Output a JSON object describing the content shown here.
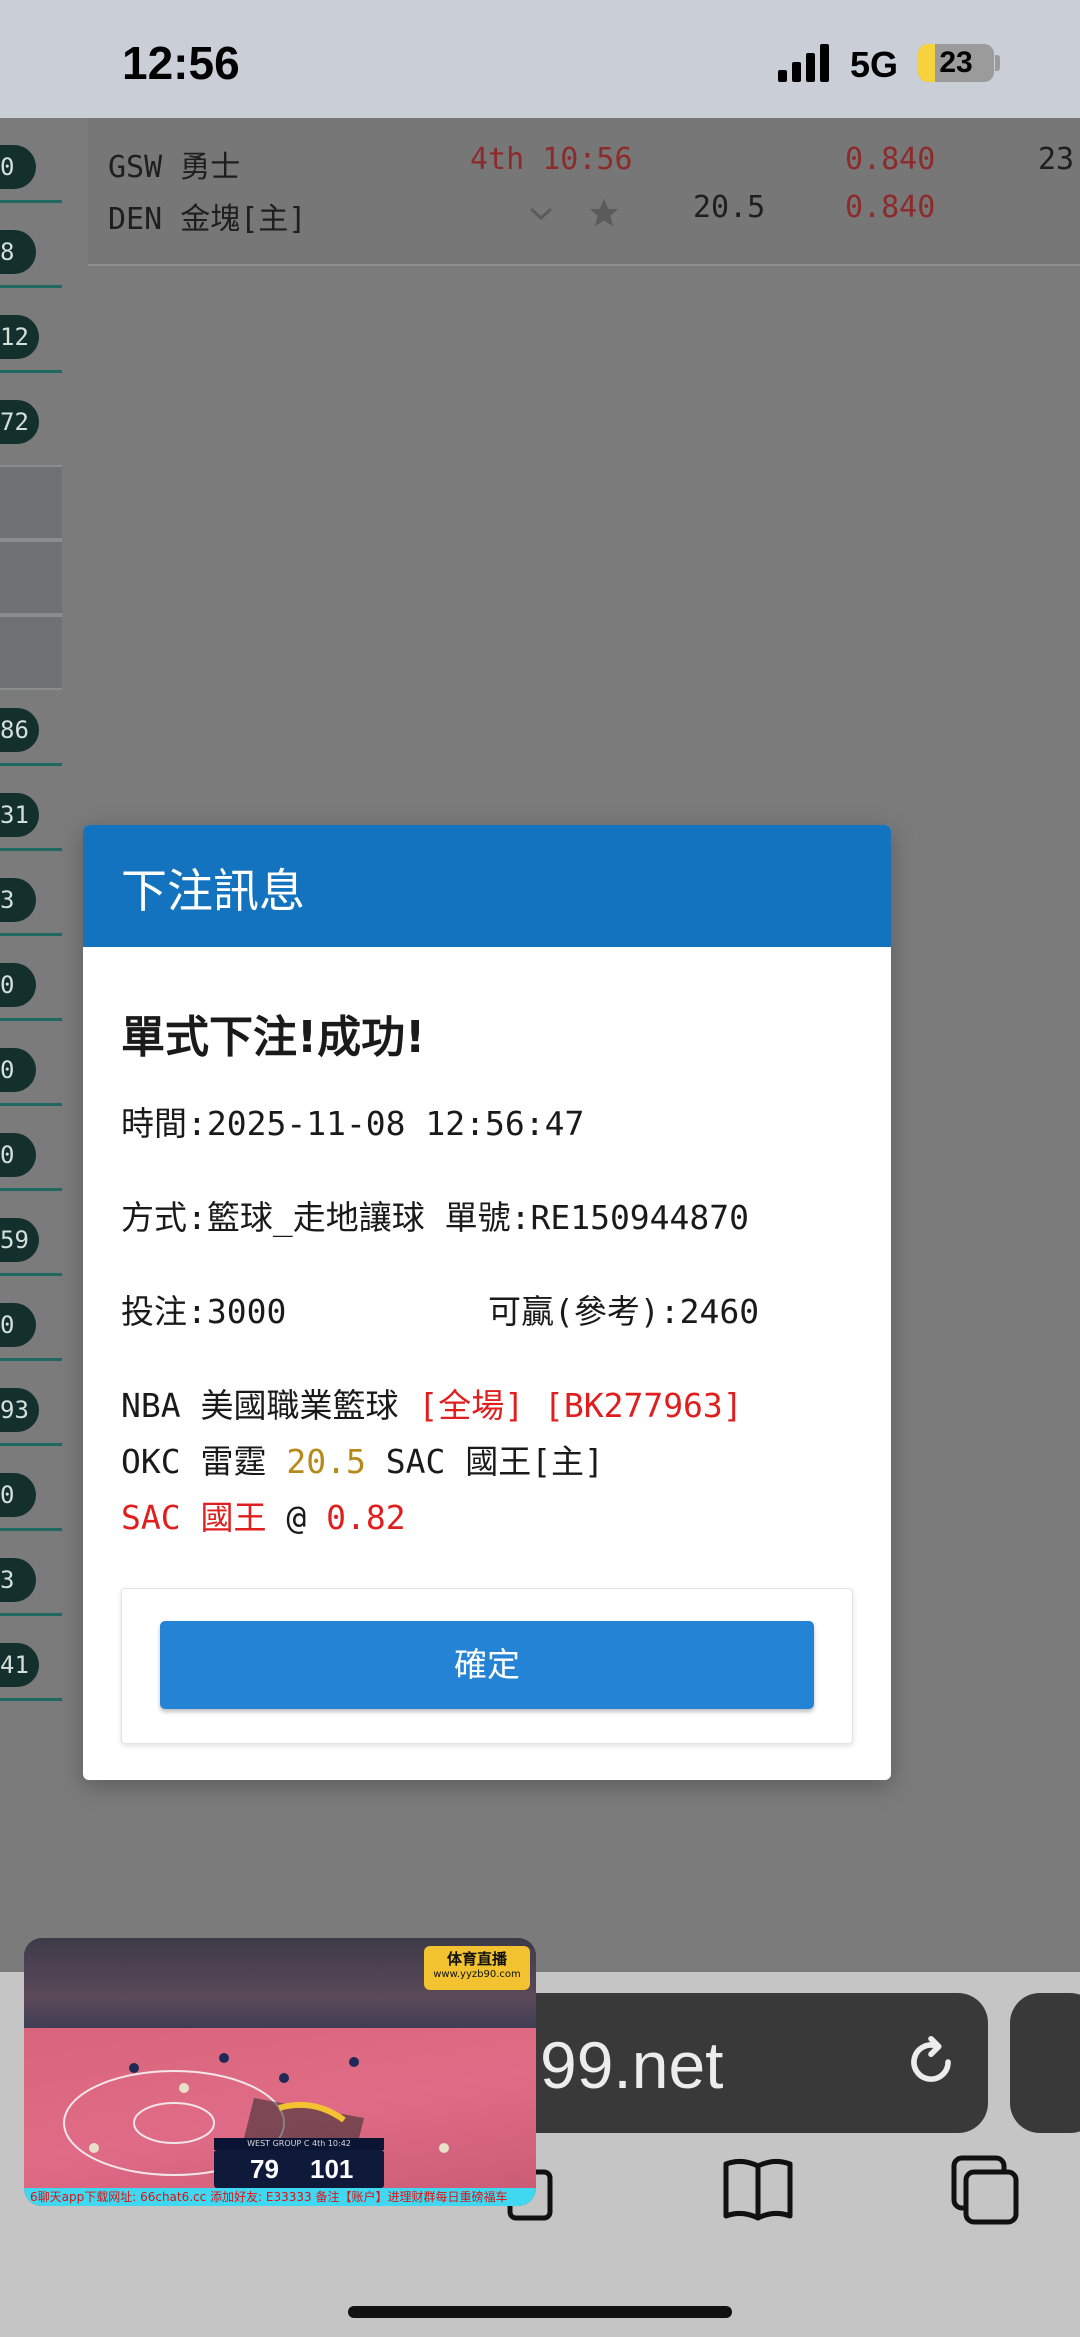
{
  "status_bar": {
    "time": "12:56",
    "network": "5G",
    "battery": "23",
    "battery_level": 0.23
  },
  "left_column": [
    "0",
    "8",
    "12",
    "72",
    "86",
    "31",
    "3",
    "0",
    "0",
    "0",
    "59",
    "0",
    "93",
    "0",
    "3",
    "41"
  ],
  "match_row": {
    "away_team": "GSW 勇士",
    "home_team": "DEN 金塊[主]",
    "period_time": "4th 10:56",
    "handicap": "20.5",
    "odds_top": "0.840",
    "odds_bottom": "0.840",
    "extra_value": "23"
  },
  "modal": {
    "title": "下注訊息",
    "result": "單式下注!成功!",
    "time_line": "時間:2025-11-08 12:56:47",
    "method_line": "方式:籃球_走地讓球 單號:RE150944870",
    "stake_line": "投注:3000",
    "payout_line": "可贏(參考):2460",
    "league": "NBA 美國職業籃球",
    "scope": "[全場]",
    "bet_code": "[BK277963]",
    "matchup_away": "OKC 雷霆",
    "matchup_line": "20.5",
    "matchup_home": "SAC 國王[主]",
    "pick": "SAC 國王",
    "at": "@",
    "pick_odds": "0.82",
    "confirm_label": "確定"
  },
  "browser": {
    "url_fragment": "99.net"
  },
  "pip": {
    "logo_text": "体育直播",
    "logo_url": "www.yyzb90.com",
    "scorebug_header": "WEST GROUP C  4th 10:42",
    "score_away": "79",
    "score_home": "101",
    "ticker": "6聊天app下载网址: 66chat6.cc  添加好友: E33333  备注【账户】进理财群每日重磅福车"
  },
  "colors": {
    "modal_header": "#1473be",
    "confirm_button": "#2483d4",
    "red_text": "#e01e1e",
    "gold_text": "#b58a1a",
    "left_pill": "#13302c"
  }
}
